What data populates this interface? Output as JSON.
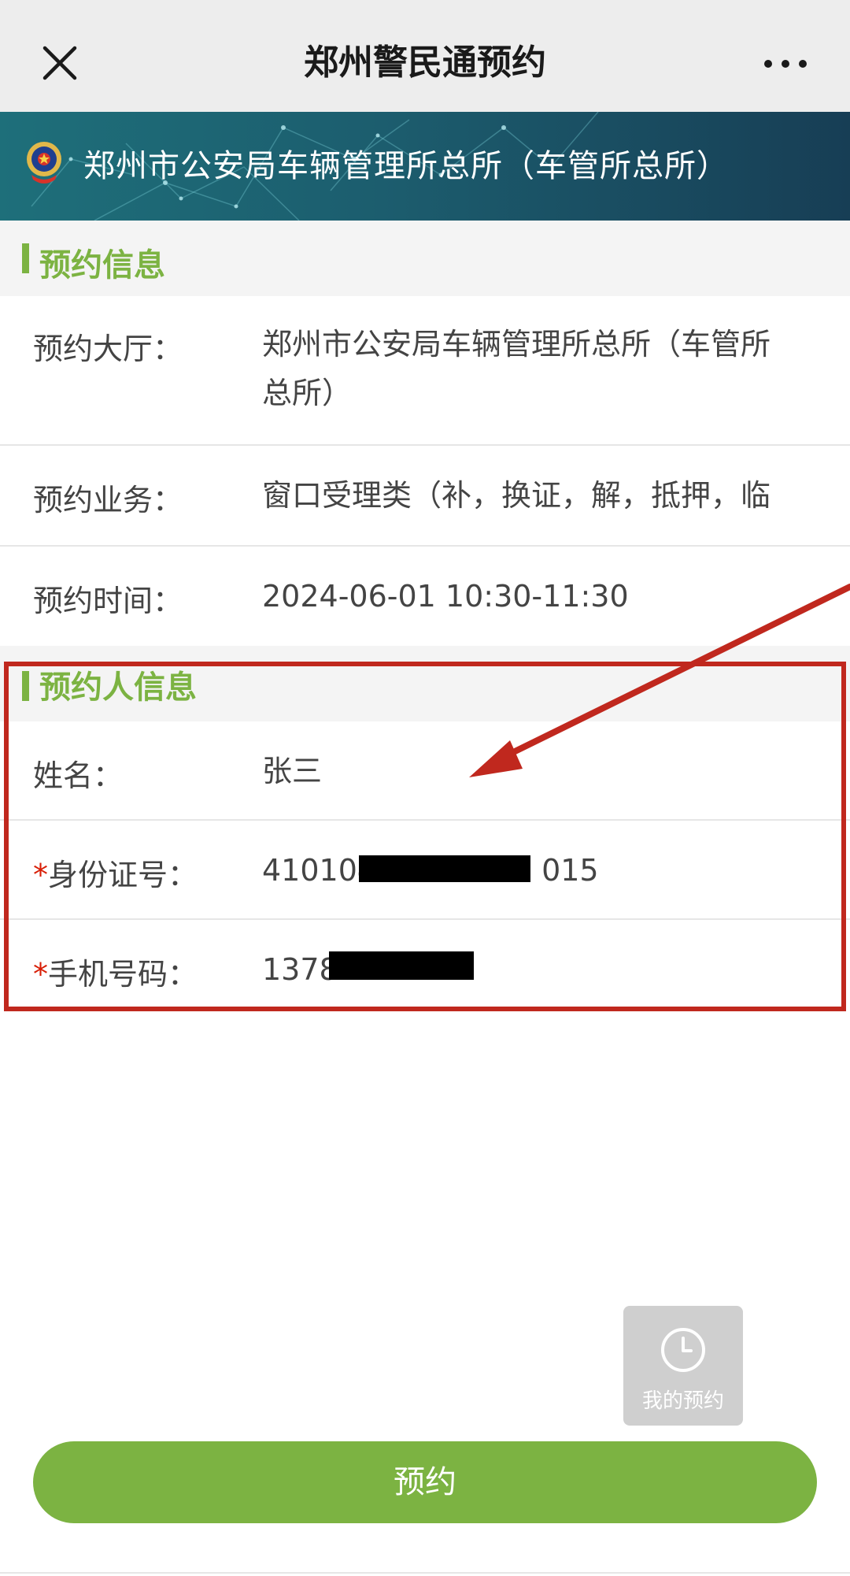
{
  "nav": {
    "title": "郑州警民通预约"
  },
  "banner": {
    "title": "郑州市公安局车辆管理所总所（车管所总所）"
  },
  "appointment_info": {
    "section_title": "预约信息",
    "hall_label": "预约大厅：",
    "hall_value_line1": "郑州市公安局车辆管理所总所（车管所",
    "hall_value_line2": "总所）",
    "service_label": "预约业务：",
    "service_value": "窗口受理类（补，换证，解，抵押，临",
    "time_label": "预约时间：",
    "time_value": "2024-06-01 10:30-11:30"
  },
  "person_info": {
    "section_title": "预约人信息",
    "name_label": "姓名：",
    "name_value": "张三",
    "required_mark": "*",
    "id_label": "身份证号：",
    "id_prefix": "410104",
    "id_suffix": "015",
    "phone_label": "手机号码：",
    "phone_prefix": "1378"
  },
  "floating": {
    "my_booking_label": "我的预约"
  },
  "submit": {
    "label": "预约"
  },
  "colors": {
    "accent": "#7cb342",
    "annotation": "#c0281e",
    "required": "#d81e06"
  },
  "icons": {
    "close": "close-icon",
    "more": "more-icon",
    "emblem": "police-emblem-icon",
    "clock": "clock-icon"
  }
}
